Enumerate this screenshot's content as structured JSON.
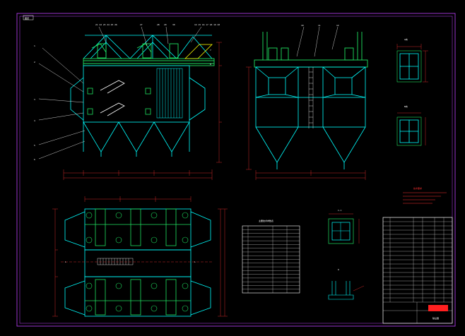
{
  "sheet": {
    "tag": "图纸",
    "colors": {
      "background": "#000000",
      "frame": "#c040ff",
      "structure": "#00ffff",
      "platform": "#20e060",
      "dimension": "#ff3030",
      "outline": "#ffffff",
      "accent": "#ffff00"
    }
  },
  "top_labels": [
    "21 22 23 24 25 26",
    "27",
    "28",
    "29",
    "30",
    "14 15 16 17 18 19 20"
  ],
  "side_labels": [
    "1",
    "2",
    "3",
    "4",
    "5",
    "6",
    "7",
    "8"
  ],
  "side_view_labels": [
    "10",
    "11",
    "12"
  ],
  "section_labels": [
    "L",
    "L"
  ],
  "detail_titles": [
    "A向",
    "B向",
    "C-C",
    "D"
  ],
  "notes_title": "技术要求",
  "parts_table": {
    "title": "主要技术参数表",
    "rows": 18
  },
  "title_block": {
    "drawing_name": "除尘器",
    "rows": 20
  }
}
